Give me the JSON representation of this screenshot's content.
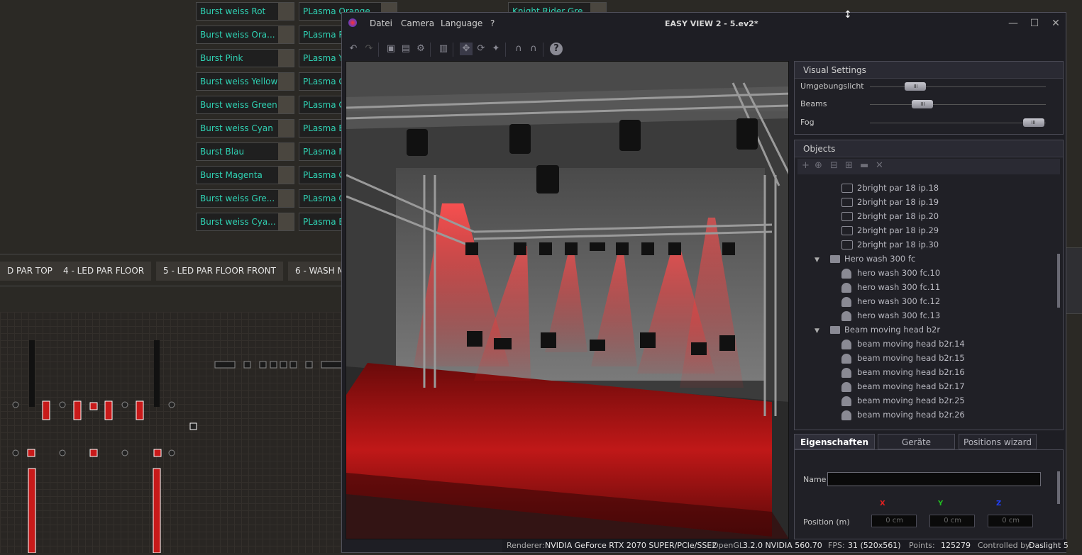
{
  "scene_buttons_col1": [
    "Burst weiss Rot",
    "Burst weiss Ora...",
    "Burst Pink",
    "Burst weiss Yellow",
    "Burst weiss Green",
    "Burst weiss Cyan",
    "Burst Blau",
    "Burst Magenta",
    "Burst weiss Gre...",
    "Burst weiss Cya..."
  ],
  "scene_buttons_col2": [
    "PLasma Orange",
    "PLasma R",
    "PLasma Y",
    "PLasma G",
    "PLasma G",
    "PLasma B",
    "PLasma M",
    "PLasma G",
    "PLasma C",
    "PLasma B"
  ],
  "scene_buttons_col3": [
    "Knight Rider Gre"
  ],
  "group_tabs": [
    "D PAR TOP",
    "4 - LED PAR FLOOR",
    "5 - LED PAR FLOOR FRONT",
    "6 - WASH M"
  ],
  "window": {
    "title": "EASY VIEW 2 - 5.ev2*",
    "menu": [
      "Datei",
      "Camera",
      "Language",
      "?"
    ],
    "minimize": "—",
    "maximize": "☐",
    "close": "✕"
  },
  "toolbar_icons": [
    "undo-icon",
    "redo-icon",
    "layout-icon",
    "view-icon",
    "settings-icon",
    "chart-icon",
    "move-icon",
    "rotate-icon",
    "pan-icon",
    "headphone-icon",
    "headphone-icon",
    "help-icon"
  ],
  "visual_settings": {
    "title": "Visual  Settings",
    "sliders": [
      {
        "label": "Umgebungslicht",
        "value": 0.26
      },
      {
        "label": "Beams",
        "value": 0.3
      },
      {
        "label": "Fog",
        "value": 0.93
      }
    ],
    "thumb_glyph": "III"
  },
  "objects": {
    "title": "Objects",
    "tools": [
      "+",
      "⊕",
      "⊟",
      "⊞",
      "▬",
      "✕"
    ],
    "rows": [
      {
        "type": "item",
        "icon": "par-icon",
        "label": "2bright par 18 ip.18"
      },
      {
        "type": "item",
        "icon": "par-icon",
        "label": "2bright par 18 ip.19"
      },
      {
        "type": "item",
        "icon": "par-icon",
        "label": "2bright par 18 ip.20"
      },
      {
        "type": "item",
        "icon": "par-icon",
        "label": "2bright par 18 ip.29"
      },
      {
        "type": "item",
        "icon": "par-icon",
        "label": "2bright par 18 ip.30"
      },
      {
        "type": "folder",
        "label": "Hero wash 300 fc"
      },
      {
        "type": "item",
        "icon": "moving-head-icon",
        "label": "hero wash 300 fc.10"
      },
      {
        "type": "item",
        "icon": "moving-head-icon",
        "label": "hero wash 300 fc.11"
      },
      {
        "type": "item",
        "icon": "moving-head-icon",
        "label": "hero wash 300 fc.12"
      },
      {
        "type": "item",
        "icon": "moving-head-icon",
        "label": "hero wash 300 fc.13"
      },
      {
        "type": "folder",
        "label": "Beam moving head b2r"
      },
      {
        "type": "item",
        "icon": "moving-head-icon",
        "label": "beam moving head b2r.14"
      },
      {
        "type": "item",
        "icon": "moving-head-icon",
        "label": "beam moving head b2r.15"
      },
      {
        "type": "item",
        "icon": "moving-head-icon",
        "label": "beam moving head b2r.16"
      },
      {
        "type": "item",
        "icon": "moving-head-icon",
        "label": "beam moving head b2r.17"
      },
      {
        "type": "item",
        "icon": "moving-head-icon",
        "label": "beam moving head b2r.25"
      },
      {
        "type": "item",
        "icon": "moving-head-icon",
        "label": "beam moving head b2r.26"
      }
    ]
  },
  "properties": {
    "tabs": [
      "Eigenschaften",
      "Geräte",
      "Positions wizard"
    ],
    "name_label": "Name",
    "name_value": "",
    "axes": [
      "X",
      "Y",
      "Z"
    ],
    "position_label": "Position (m)",
    "position_values": [
      "0 cm",
      "0 cm",
      "0 cm"
    ],
    "colors": {
      "x": "#e02020",
      "y": "#20c020",
      "z": "#2040ff"
    }
  },
  "status": {
    "renderer_label": "Renderer:",
    "renderer_value": "NVIDIA GeForce RTX 2070 SUPER/PCIe/SSE2",
    "opengl_label": "OpenGL:",
    "opengl_value": "3.2.0 NVIDIA 560.70",
    "fps_label": "FPS:",
    "fps_value": "31 (520x561)",
    "points_label": "Points:",
    "points_value": "125279",
    "controlled_label": "Controlled by:",
    "controlled_value": "Daslight 5"
  },
  "accent_colors": {
    "scene_text": "#2fd1b3",
    "beam_red": "#ff2a2a"
  }
}
